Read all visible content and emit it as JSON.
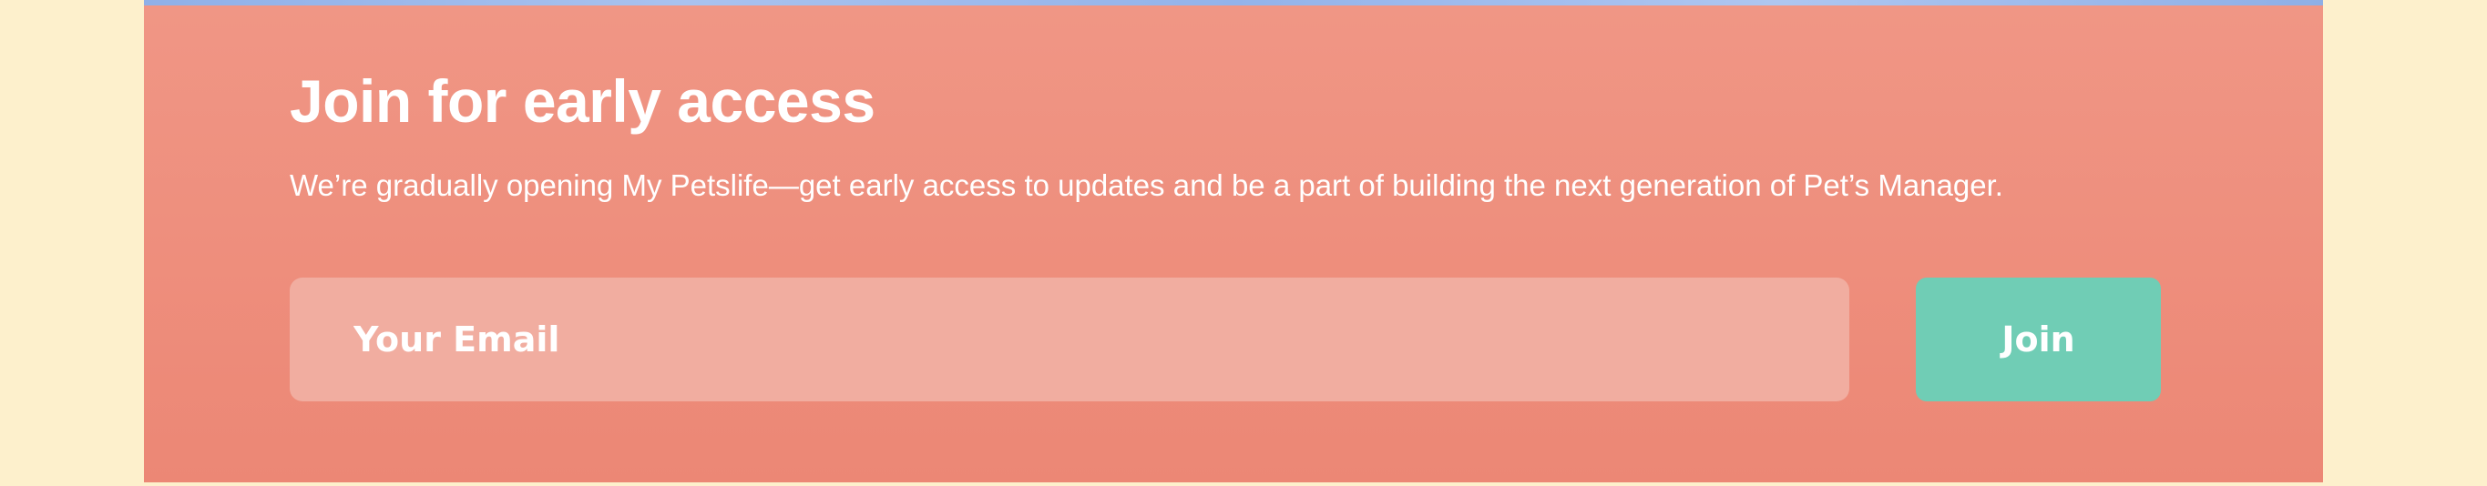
{
  "signup": {
    "title": "Join for early access",
    "subtitle": "We’re gradually opening My Petslife—get early access to updates and be a part of building the next generation of Pet’s Manager.",
    "email_placeholder": "Your Email",
    "join_label": "Join"
  },
  "colors": {
    "page_background": "#fdf0cc",
    "card_background": "#ee8e7c",
    "input_background": "#f1ada0",
    "button_background": "#70cdb5",
    "text": "#ffffff"
  }
}
